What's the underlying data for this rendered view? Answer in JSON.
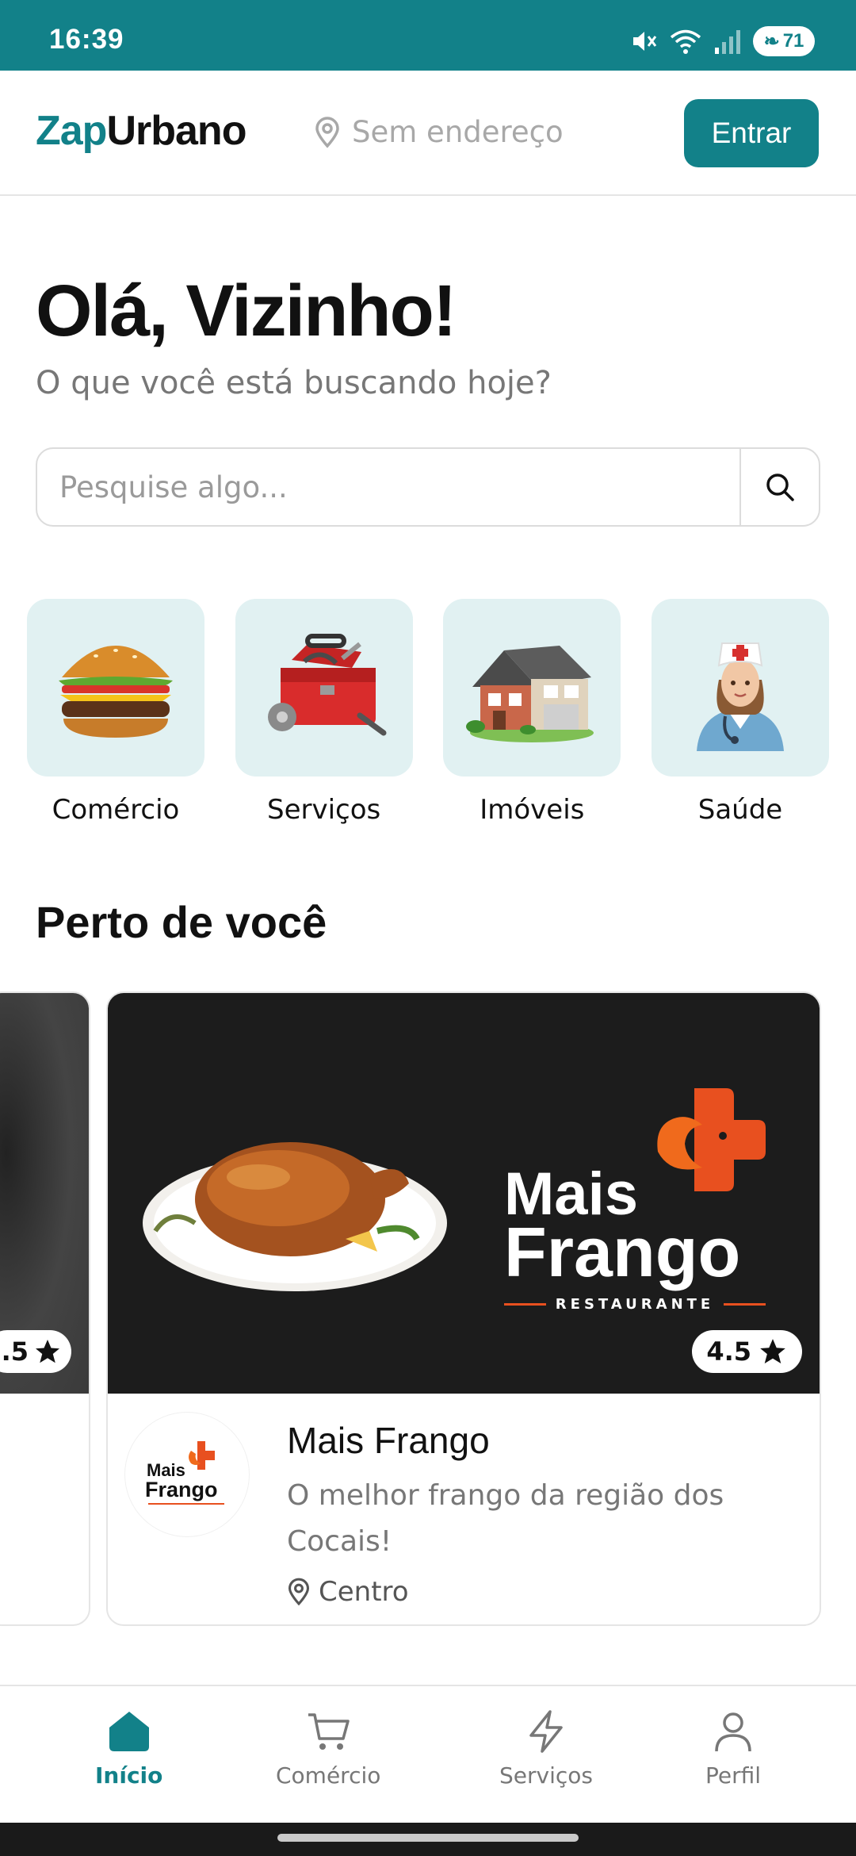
{
  "status_bar": {
    "time": "16:39",
    "battery": "71",
    "wifi_label": "6"
  },
  "header": {
    "brand_part1": "Zap",
    "brand_part2": "Urbano",
    "address": "Sem endereço",
    "login_label": "Entrar"
  },
  "hero": {
    "greeting": "Olá, Vizinho!",
    "subtitle": "O que você está buscando hoje?"
  },
  "search": {
    "placeholder": "Pesquise algo..."
  },
  "categories": [
    {
      "label": "Comércio",
      "icon": "burger-icon"
    },
    {
      "label": "Serviços",
      "icon": "toolbox-icon"
    },
    {
      "label": "Imóveis",
      "icon": "house-icon"
    },
    {
      "label": "Saúde",
      "icon": "nurse-icon"
    }
  ],
  "nearby": {
    "title": "Perto de você",
    "partial_rating": ".5",
    "card": {
      "rating": "4.5",
      "brand_word1": "Mais",
      "brand_word2": "Frango",
      "brand_tag": "RESTAURANTE",
      "name": "Mais Frango",
      "description": "O melhor frango da região dos Cocais!",
      "location": "Centro"
    }
  },
  "bottom_nav": [
    {
      "label": "Início",
      "icon": "home-icon",
      "active": true
    },
    {
      "label": "Comércio",
      "icon": "cart-icon",
      "active": false
    },
    {
      "label": "Serviços",
      "icon": "bolt-icon",
      "active": false
    },
    {
      "label": "Perfil",
      "icon": "user-icon",
      "active": false
    }
  ],
  "colors": {
    "brand": "#128189",
    "category_tile": "#e1f1f2",
    "banner_bg": "#1c1c1c",
    "banner_accent": "#e8501f"
  }
}
